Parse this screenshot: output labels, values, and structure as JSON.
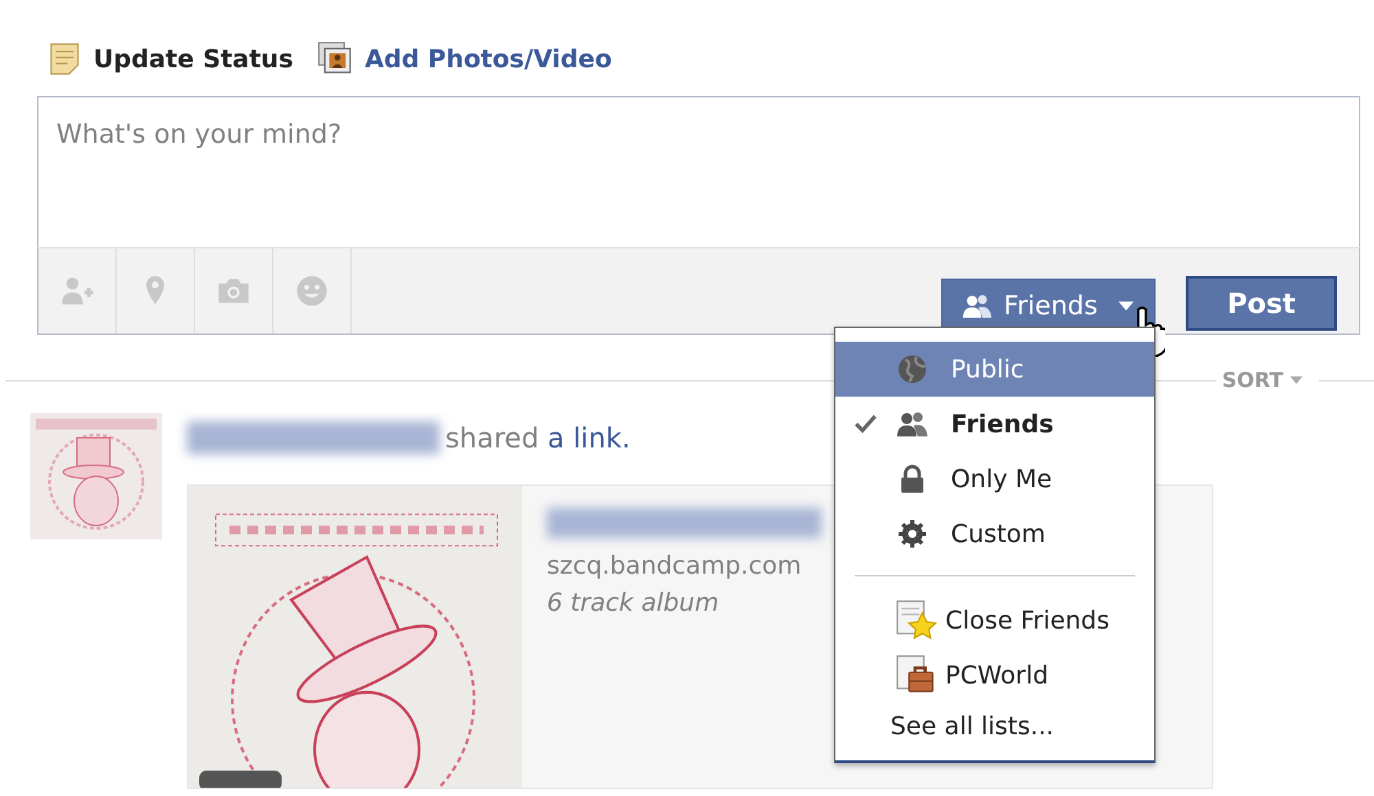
{
  "composer": {
    "tabs": [
      {
        "label": "Update Status",
        "selected": true
      },
      {
        "label": "Add Photos/Video",
        "selected": false
      }
    ],
    "placeholder": "What's on your mind?",
    "audience_button": {
      "label": "Friends",
      "expanded": true
    },
    "post_button": "Post"
  },
  "audience_menu": [
    {
      "kind": "option",
      "label": "Public",
      "checked": false,
      "highlighted": true
    },
    {
      "kind": "option",
      "label": "Friends",
      "checked": true,
      "highlighted": false
    },
    {
      "kind": "option",
      "label": "Only Me",
      "checked": false,
      "highlighted": false
    },
    {
      "kind": "option",
      "label": "Custom",
      "checked": false,
      "highlighted": false
    },
    {
      "kind": "divider"
    },
    {
      "kind": "list",
      "label": "Close Friends",
      "checked": false,
      "highlighted": false
    },
    {
      "kind": "list",
      "label": "PCWorld",
      "checked": false,
      "highlighted": false
    },
    {
      "kind": "link",
      "label": "See all lists...",
      "checked": false,
      "highlighted": false
    }
  ],
  "feed": {
    "sort": "SORT",
    "story": {
      "action": "shared",
      "link": "a link.",
      "attachment": {
        "kind": "picture",
        "domain": "szcq.bandcamp.com",
        "caption": "6 track album"
      }
    }
  }
}
